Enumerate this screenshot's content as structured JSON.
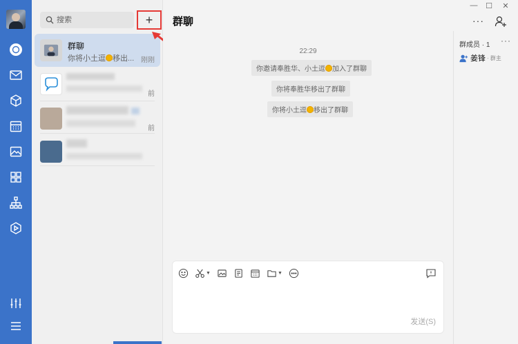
{
  "search": {
    "placeholder": "搜索"
  },
  "add_button": {
    "label": "+"
  },
  "conversations": [
    {
      "name": "群聊",
      "preview_prefix": "你将小土逗",
      "preview_suffix": "移出...",
      "time": "刚刚"
    },
    {
      "name": "",
      "preview": "",
      "time": "前"
    },
    {
      "name": "",
      "preview": "",
      "time": "前"
    },
    {
      "name": "",
      "preview": "",
      "time": ""
    }
  ],
  "chat": {
    "title": "群聊",
    "time": "22:29",
    "notices": [
      {
        "prefix": "你邀请奉胜华、小土逗",
        "suffix": "加入了群聊",
        "has_emoji": true
      },
      {
        "prefix": "你将奉胜华移出了群聊",
        "suffix": "",
        "has_emoji": false
      },
      {
        "prefix": "你将小土逗",
        "suffix": "移出了群聊",
        "has_emoji": true
      }
    ],
    "send_label": "发送(S)"
  },
  "members": {
    "header": "群成员 · 1",
    "more": "···",
    "list": [
      {
        "name": "姜锋",
        "role": "· 群主"
      }
    ]
  },
  "header_actions": {
    "more": "···"
  },
  "window_controls": {
    "minimize": "—",
    "maximize": "☐",
    "close": "✕"
  },
  "colors": {
    "rail": "#3b73c9",
    "selected": "#cfdcee",
    "highlight": "#e53935",
    "emoji": "#f2b400"
  },
  "icons": {
    "rail": [
      "chat-icon",
      "mail-icon",
      "docs-icon",
      "calendar-icon",
      "photo-icon",
      "apps-icon",
      "org-icon",
      "video-icon",
      "settings-icon",
      "menu-icon"
    ],
    "toolbar": [
      "emoji-icon",
      "scissors-icon",
      "image-icon",
      "file-icon",
      "calendar-icon",
      "folder-icon",
      "more-icon"
    ]
  }
}
